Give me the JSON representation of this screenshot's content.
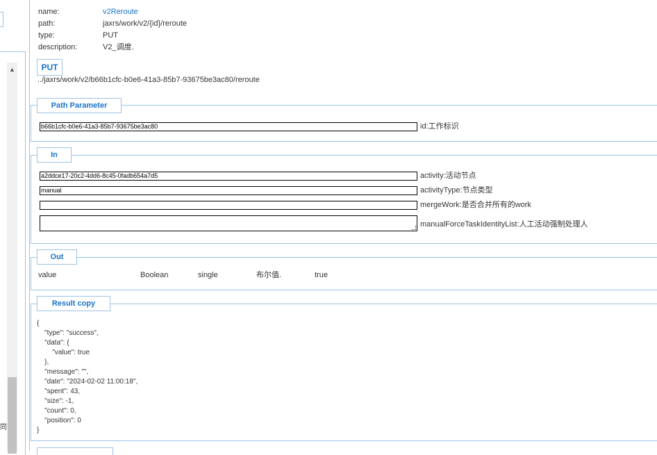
{
  "sidebar": {
    "scroll_up_glyph": "▲",
    "partial_char": "同"
  },
  "info": {
    "name_key": "name:",
    "name_val": "v2Reroute",
    "path_key": "path:",
    "path_val": "jaxrs/work/v2/{id}/reroute",
    "type_key": "type:",
    "type_val": "PUT",
    "desc_key": "description:",
    "desc_val": "V2_调度."
  },
  "method_badge": "PUT",
  "full_path": "../jaxrs/work/v2/b66b1cfc-b0e6-41a3-85b7-93675be3ac80/reroute",
  "path_param": {
    "title": "Path Parameter",
    "id_value": "b66b1cfc-b0e6-41a3-85b7-93675be3ac80",
    "id_label": "id:工作标识"
  },
  "in_section": {
    "title": "In",
    "activity_value": "a2ddce17-20c2-4dd6-8c45-0fadb654a7d5",
    "activity_label": "activity:活动节点",
    "activityType_value": "manual",
    "activityType_label": "activityType:节点类型",
    "mergeWork_value": "",
    "mergeWork_label": "mergeWork:是否合并所有的work",
    "manualForce_value": "",
    "manualForce_label": "manualForceTaskIdentityList:人工活动强制处理人"
  },
  "out_section": {
    "title": "Out",
    "name": "value",
    "type": "Boolean",
    "multiplicity": "single",
    "description": "布尔值.",
    "example": "true"
  },
  "result_section": {
    "title": "Result copy",
    "lines": [
      "{",
      "    \"type\": \"success\",",
      "    \"data\": {",
      "        \"value\": true",
      "    },",
      "    \"message\": \"\",",
      "    \"date\": \"2024-02-02 11:00:18\",",
      "    \"spent\": 43,",
      "    \"size\": -1,",
      "    \"count\": 0,",
      "    \"position\": 0",
      "}"
    ]
  }
}
